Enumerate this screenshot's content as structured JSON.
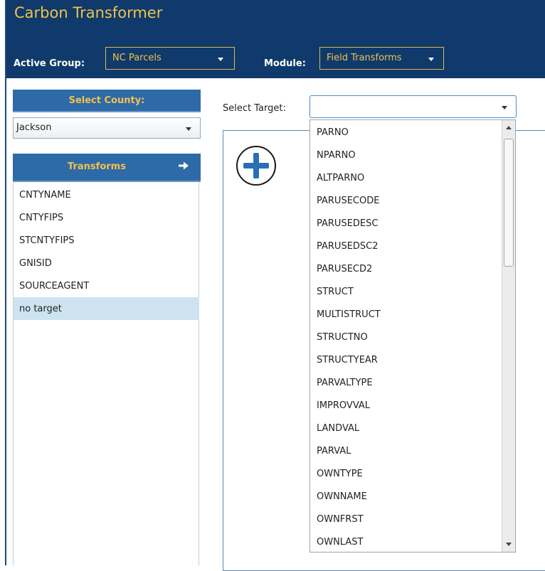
{
  "app": {
    "title": "Carbon Transformer"
  },
  "header": {
    "active_group_label": "Active Group:",
    "active_group_value": "NC Parcels",
    "module_label": "Module:",
    "module_value": "Field Transforms"
  },
  "county": {
    "heading": "Select County:",
    "selected": "Jackson"
  },
  "transforms": {
    "heading": "Transforms",
    "items": [
      "CNTYNAME",
      "CNTYFIPS",
      "STCNTYFIPS",
      "GNISID",
      "SOURCEAGENT",
      "no target"
    ],
    "selected_index": 5
  },
  "target": {
    "label": "Select Target:",
    "value": "",
    "options": [
      "PARNO",
      "NPARNO",
      "ALTPARNO",
      "PARUSECODE",
      "PARUSEDESC",
      "PARUSEDSC2",
      "PARUSECD2",
      "STRUCT",
      "MULTISTRUCT",
      "STRUCTNO",
      "STRUCTYEAR",
      "PARVALTYPE",
      "IMPROVVAL",
      "LANDVAL",
      "PARVAL",
      "OWNTYPE",
      "OWNNAME",
      "OWNFRST",
      "OWNLAST"
    ]
  },
  "icons": {
    "add": "plus-circle-icon",
    "transforms_arrow": "arrow-right-icon"
  },
  "colors": {
    "header_bg": "#0f3a6b",
    "accent": "#f0c24a",
    "panel_head": "#2f6aa8",
    "selected_row": "#cde4f0"
  }
}
